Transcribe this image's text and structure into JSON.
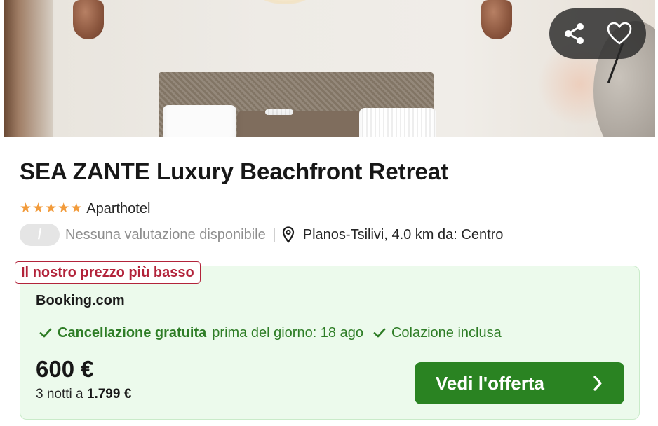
{
  "hotel": {
    "name": "SEA ZANTE Luxury Beachfront Retreat",
    "stars": 5,
    "type": "Aparthotel",
    "rating_badge": "/",
    "rating_text": "Nessuna valutazione disponibile",
    "location": "Planos-Tsilivi, 4.0 km da: Centro"
  },
  "offer": {
    "badge": "Il nostro prezzo più basso",
    "provider": "Booking.com",
    "cancellation_label": "Cancellazione gratuita",
    "cancellation_detail": "prima del giorno: 18 ago",
    "breakfast_label": "Colazione inclusa",
    "price": "600 €",
    "nights_prefix": "3 notti a",
    "total_price": "1.799 €",
    "cta_label": "Vedi l'offerta"
  },
  "icons": {
    "share": "share-icon",
    "favorite": "heart-icon",
    "location": "map-pin-icon",
    "check": "check-icon",
    "arrow": "chevron-right-icon"
  },
  "colors": {
    "star": "#f29b3b",
    "cta_background": "#2a8322",
    "feature_green": "#2e7d26",
    "badge_red": "#b2233a",
    "offer_background": "#ecfaec"
  }
}
